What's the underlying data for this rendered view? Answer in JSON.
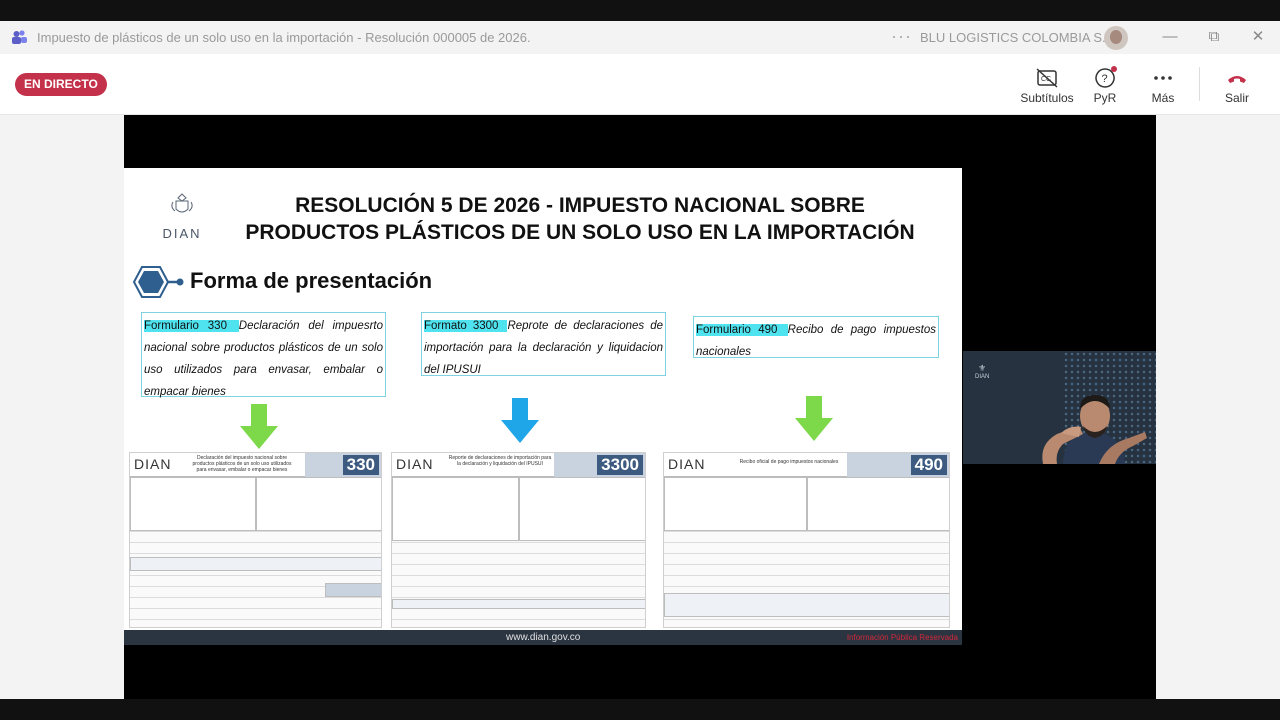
{
  "window": {
    "title": "Impuesto de plásticos de un solo uso en la importación - Resolución 000005 de 2026.",
    "more": "···",
    "organization": "BLU LOGISTICS COLOMBIA S.A.S",
    "minimize": "—",
    "restore": "⧉",
    "close": "✕"
  },
  "toolbar": {
    "live_badge": "EN DIRECTO",
    "captions_label": "Subtítulos",
    "qa_label": "PyR",
    "more_label": "Más",
    "leave_label": "Salir",
    "accent": "#c4314b"
  },
  "slide": {
    "logo_text": "DIAN",
    "title_line1": "RESOLUCIÓN 5 DE 2026 -  IMPUESTO NACIONAL SOBRE",
    "title_line2": "PRODUCTOS PLÁSTICOS DE UN SOLO USO EN LA IMPORTACIÓN",
    "section_heading": "Forma de presentación",
    "items": [
      {
        "code": "Formulario  330 ",
        "description": " Declaración del impuesrto nacional sobre productos plásticos de un solo uso utilizados para envasar, embalar o empacar bienes",
        "arrow_color": "#7dd84a",
        "form_number": "330",
        "form_title": "Declaración del impuesto nacional sobre productos plásticos de un solo uso utilizados para envasar, embalar o empacar bienes"
      },
      {
        "code": "Formato  3300 ",
        "description": " Reprote de declaraciones de importación para la declaración y liquidacion del IPUSUI",
        "arrow_color": "#1fa6e8",
        "form_number": "3300",
        "form_title": "Reporte de declaraciones de importación para la declaración y liquidación del IPUSUI"
      },
      {
        "code": "Formulario  490 ",
        "description": " Recibo de pago impuestos nacionales",
        "arrow_color": "#7dd84a",
        "form_number": "490",
        "form_title": "Recibo oficial de pago impuestos nacionales"
      }
    ],
    "footer_url": "www.dian.gov.co",
    "footer_classification": "Información Pública Reservada"
  },
  "camera": {
    "logo_text": "DIAN"
  }
}
